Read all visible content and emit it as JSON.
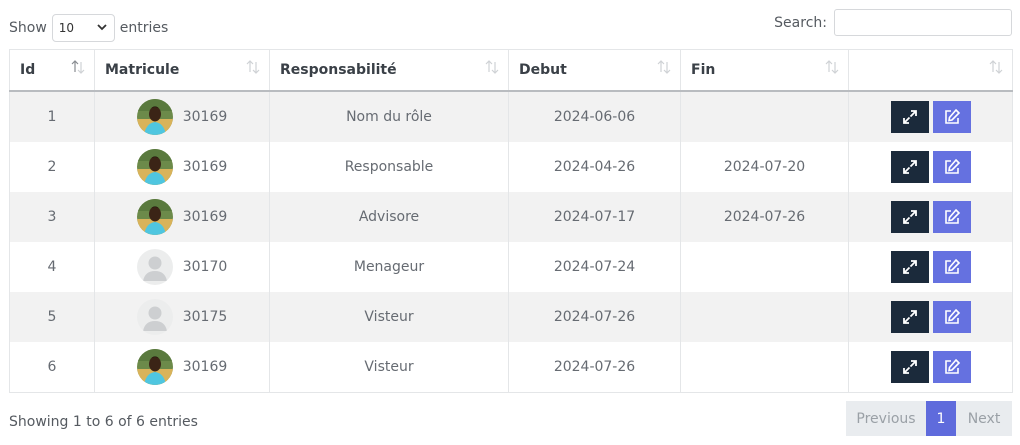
{
  "controls": {
    "show_label": "Show",
    "page_length": "10",
    "entries_label": "entries",
    "search_label": "Search:",
    "search_value": ""
  },
  "table": {
    "columns": [
      "Id",
      "Matricule",
      "Responsabilité",
      "Debut",
      "Fin",
      ""
    ],
    "rows": [
      {
        "id": "1",
        "avatar": "photo",
        "matricule": "30169",
        "responsabilite": "Nom du rôle",
        "debut": "2024-06-06",
        "fin": ""
      },
      {
        "id": "2",
        "avatar": "photo",
        "matricule": "30169",
        "responsabilite": "Responsable",
        "debut": "2024-04-26",
        "fin": "2024-07-20"
      },
      {
        "id": "3",
        "avatar": "photo",
        "matricule": "30169",
        "responsabilite": "Advisore",
        "debut": "2024-07-17",
        "fin": "2024-07-26"
      },
      {
        "id": "4",
        "avatar": "placeholder",
        "matricule": "30170",
        "responsabilite": "Menageur",
        "debut": "2024-07-24",
        "fin": ""
      },
      {
        "id": "5",
        "avatar": "placeholder",
        "matricule": "30175",
        "responsabilite": "Visteur",
        "debut": "2024-07-26",
        "fin": ""
      },
      {
        "id": "6",
        "avatar": "photo",
        "matricule": "30169",
        "responsabilite": "Visteur",
        "debut": "2024-07-26",
        "fin": ""
      }
    ],
    "row_actions": {
      "expand_icon": "expand-arrows-icon",
      "edit_icon": "edit-pencil-icon"
    }
  },
  "footer": {
    "info": "Showing 1 to 6 of 6 entries",
    "prev_label": "Previous",
    "current_page": "1",
    "next_label": "Next"
  },
  "colors": {
    "expand_button": "#1b2a3b",
    "edit_button": "#6571e0",
    "active_page": "#5f6bdc",
    "stripe": "#f2f2f2"
  }
}
